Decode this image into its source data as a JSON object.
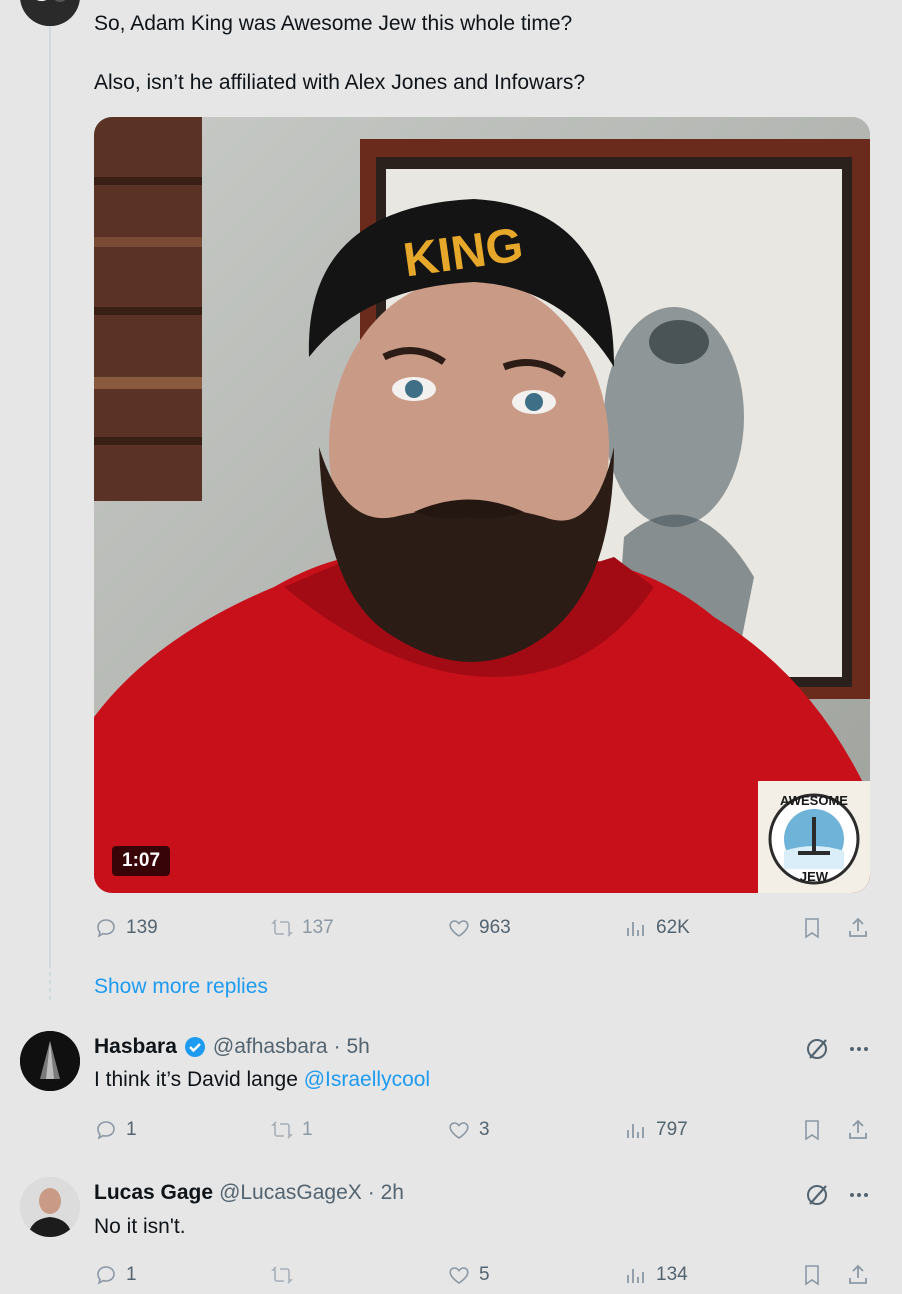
{
  "main_tweet": {
    "line1": "So, Adam King was Awesome Jew this whole time?",
    "line2": "Also, isn’t he affiliated with Alex Jones and Infowars?",
    "video_duration": "1:07",
    "hat_text": "KING",
    "logo_top": "AWESOME",
    "logo_bottom": "JEW",
    "stats": {
      "replies": "139",
      "reposts": "137",
      "likes": "963",
      "views": "62K"
    }
  },
  "show_more_replies": "Show more replies",
  "replies": [
    {
      "name": "Hasbara",
      "verified": true,
      "handle": "@afhasbara",
      "time": "· 5h",
      "text": "I think it’s David lange ",
      "mention": "@Israellycool",
      "stats": {
        "replies": "1",
        "reposts": "1",
        "likes": "3",
        "views": "797"
      }
    },
    {
      "name": "Lucas Gage",
      "verified": false,
      "handle": "@LucasGageX",
      "time": "· 2h",
      "text": "No it isn't.",
      "stats": {
        "replies": "1",
        "reposts": "",
        "likes": "5",
        "views": "134"
      }
    }
  ],
  "colors": {
    "accent": "#1d9bf0",
    "text": "#0f1419",
    "muted": "#536471",
    "background": "#e6e6e6"
  },
  "icons": [
    "reply-icon",
    "repost-icon",
    "like-icon",
    "views-icon",
    "bookmark-icon",
    "share-icon",
    "verified-badge-icon",
    "grok-icon",
    "more-icon"
  ]
}
